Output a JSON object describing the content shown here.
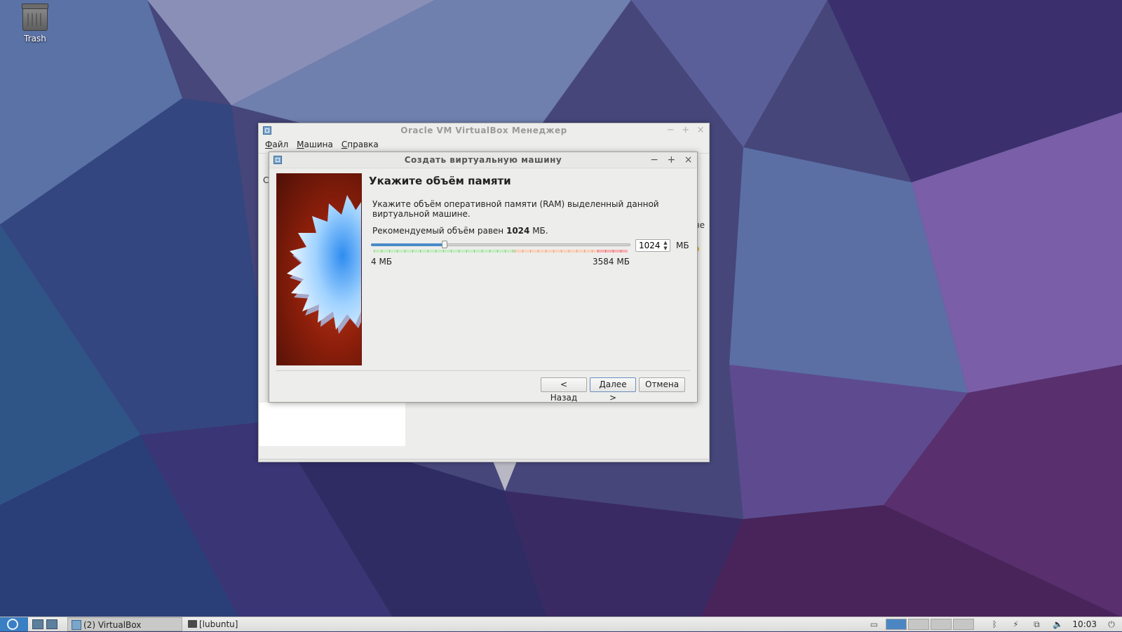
{
  "desktop": {
    "trash_label": "Trash"
  },
  "manager_window": {
    "title": "Oracle VM VirtualBox Менеджер",
    "menu": [
      "Файл",
      "Машина",
      "Справка"
    ],
    "left_fragment": "С",
    "right_fragment": "не",
    "controls": {
      "minimize": "−",
      "maximize": "+",
      "close": "×"
    }
  },
  "wizard": {
    "title": "Создать виртуальную машину",
    "controls": {
      "minimize": "−",
      "maximize": "+",
      "close": "×"
    },
    "page_title": "Укажите объём памяти",
    "description": "Укажите объём оперативной памяти (RAM) выделенный данной виртуальной машине.",
    "recommend_prefix": "Рекомендуемый объём равен ",
    "recommend_value": "1024",
    "recommend_suffix": " МБ.",
    "memory": {
      "value": "1024",
      "unit": "МБ",
      "min_label": "4 МБ",
      "max_label": "3584 МБ",
      "min": 4,
      "max": 3584,
      "current": 1024
    },
    "buttons": {
      "back": "< Назад",
      "next": "Далее >",
      "cancel": "Отмена"
    }
  },
  "taskbar": {
    "tasks": [
      "(2) VirtualBox",
      "[lubuntu]"
    ],
    "clock": "10:03"
  },
  "colors": {
    "accent": "#4a8bc9",
    "window_bg": "#ededeb"
  }
}
